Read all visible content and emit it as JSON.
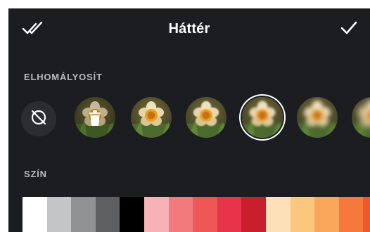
{
  "header": {
    "title": "Háttér",
    "left_icon": "double-check-icon",
    "right_icon": "check-icon"
  },
  "blur_section": {
    "label": "ELHOMÁLYOSÍT",
    "items": [
      {
        "kind": "none",
        "icon": "no-blur-icon"
      },
      {
        "kind": "photo",
        "blur": 0,
        "overlay_icon": "trash-icon"
      },
      {
        "kind": "photo",
        "blur": 0
      },
      {
        "kind": "photo",
        "blur": 0.8
      },
      {
        "kind": "photo",
        "blur": 1.6,
        "selected": true
      },
      {
        "kind": "photo",
        "blur": 3
      },
      {
        "kind": "photo",
        "blur": 4.5
      }
    ]
  },
  "color_section": {
    "label": "SZÍN",
    "swatches": [
      "#ffffff",
      "#c3c5c7",
      "#8f9193",
      "#5d5f61",
      "#000000",
      "#f7b2b7",
      "#f27a7c",
      "#ef5656",
      "#e8344a",
      "#c91f2c",
      "#fde0b8",
      "#fcc77c",
      "#f9a85b",
      "#f5783d",
      "#f0572c"
    ]
  }
}
